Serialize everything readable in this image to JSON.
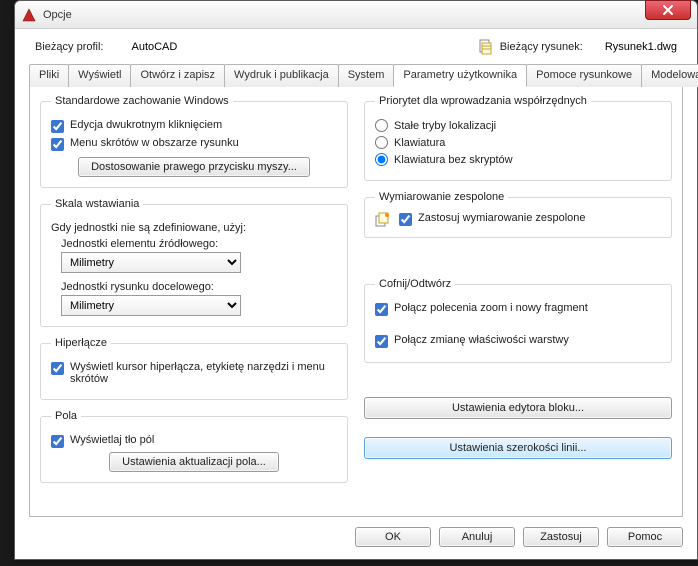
{
  "window": {
    "title": "Opcje"
  },
  "header": {
    "profile_label": "Bieżący profil:",
    "profile_value": "AutoCAD",
    "drawing_label": "Bieżący rysunek:",
    "drawing_value": "Rysunek1.dwg"
  },
  "tabs": {
    "items": [
      "Pliki",
      "Wyświetl",
      "Otwórz i zapisz",
      "Wydruk i publikacja",
      "System",
      "Parametry użytkownika",
      "Pomoce rysunkowe",
      "Modelowan"
    ],
    "active": 5,
    "scroll_left": "◂",
    "scroll_right": "▸"
  },
  "left": {
    "winbehave": {
      "legend": "Standardowe zachowanie Windows",
      "dblclick": "Edycja dwukrotnym kliknięciem",
      "shortcut": "Menu skrótów w obszarze rysunku",
      "rmb_btn": "Dostosowanie prawego przycisku myszy..."
    },
    "scale": {
      "legend": "Skala wstawiania",
      "hint": "Gdy jednostki nie są zdefiniowane, użyj:",
      "src_label": "Jednostki elementu źródłowego:",
      "src_value": "Milimetry",
      "dst_label": "Jednostki rysunku docelowego:",
      "dst_value": "Milimetry"
    },
    "hyperlink": {
      "legend": "Hiperłącze",
      "show": "Wyświetl kursor hiperłącza, etykietę narzędzi i menu skrótów"
    },
    "fields": {
      "legend": "Pola",
      "showbg": "Wyświetlaj tło pól",
      "update_btn": "Ustawienia aktualizacji pola..."
    }
  },
  "right": {
    "priority": {
      "legend": "Priorytet dla wprowadzania współrzędnych",
      "opt1": "Stałe tryby lokalizacji",
      "opt2": "Klawiatura",
      "opt3": "Klawiatura bez skryptów"
    },
    "dim": {
      "legend": "Wymiarowanie zespolone",
      "apply": "Zastosuj wymiarowanie zespolone"
    },
    "undo": {
      "legend": "Cofnij/Odtwórz",
      "zoom": "Połącz polecenia zoom i nowy fragment",
      "layer": "Połącz zmianę właściwości warstwy"
    },
    "blockeditor_btn": "Ustawienia edytora bloku...",
    "linewidth_btn": "Ustawienia szerokości linii..."
  },
  "footer": {
    "ok": "OK",
    "cancel": "Anuluj",
    "apply": "Zastosuj",
    "help": "Pomoc"
  }
}
